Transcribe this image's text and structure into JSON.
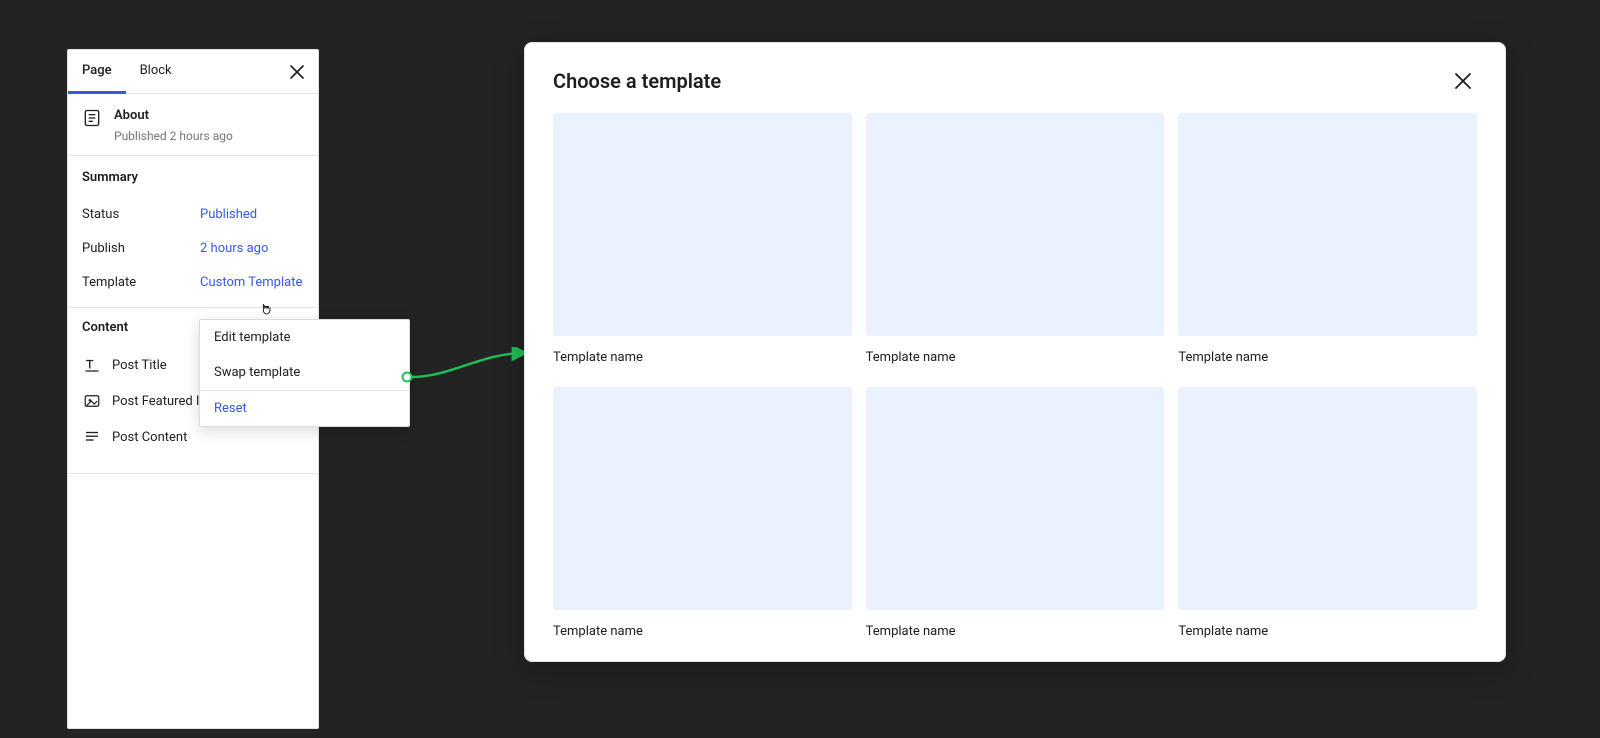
{
  "sidebar": {
    "tabs": {
      "page": "Page",
      "block": "Block"
    },
    "page_title": "About",
    "page_subtitle": "Published 2 hours ago",
    "summary": {
      "section": "Summary",
      "status_label": "Status",
      "status_value": "Published",
      "publish_label": "Publish",
      "publish_value": "2 hours ago",
      "template_label": "Template",
      "template_value": "Custom Template"
    },
    "content": {
      "section": "Content",
      "items": [
        {
          "label": "Post Title"
        },
        {
          "label": "Post Featured Image"
        },
        {
          "label": "Post Content"
        }
      ]
    }
  },
  "popover": {
    "edit": "Edit template",
    "swap": "Swap template",
    "reset": "Reset"
  },
  "modal": {
    "title": "Choose a template",
    "templates": [
      {
        "name": "Template name"
      },
      {
        "name": "Template name"
      },
      {
        "name": "Template name"
      },
      {
        "name": "Template name"
      },
      {
        "name": "Template name"
      },
      {
        "name": "Template name"
      }
    ]
  }
}
